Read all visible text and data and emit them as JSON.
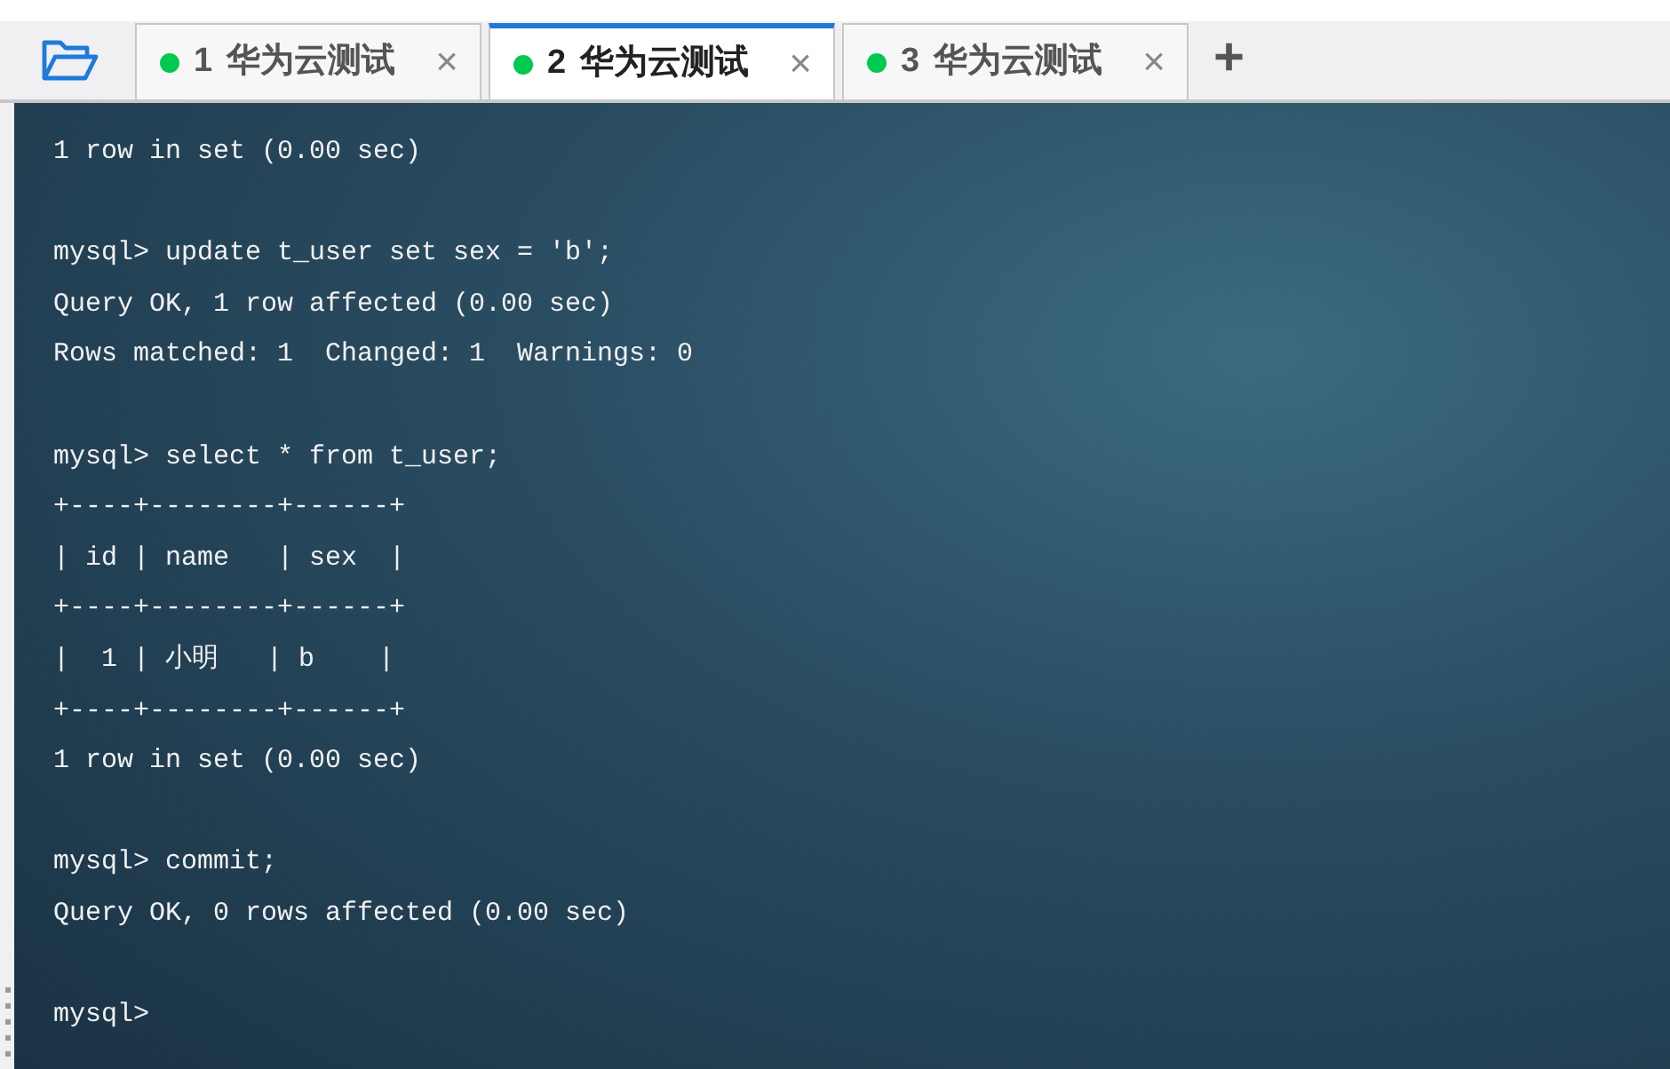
{
  "tabs": [
    {
      "number": "1",
      "label": "华为云测试",
      "selected": false,
      "connected": true,
      "close": "×"
    },
    {
      "number": "2",
      "label": "华为云测试",
      "selected": true,
      "connected": true,
      "close": "×"
    },
    {
      "number": "3",
      "label": "华为云测试",
      "selected": false,
      "connected": true,
      "close": "×"
    }
  ],
  "new_tab": "+",
  "terminal": {
    "blocks": [
      [
        "1 row in set (0.00 sec)"
      ],
      [
        "mysql> update t_user set sex = 'b';",
        "Query OK, 1 row affected (0.00 sec)",
        "Rows matched: 1  Changed: 1  Warnings: 0"
      ],
      [
        "mysql> select * from t_user;",
        "+----+--------+------+",
        "| id | name   | sex  |",
        "+----+--------+------+",
        "|  1 | 小明   | b    |",
        "+----+--------+------+",
        "1 row in set (0.00 sec)"
      ],
      [
        "mysql> commit;",
        "Query OK, 0 rows affected (0.00 sec)"
      ],
      [
        "mysql>"
      ]
    ]
  }
}
